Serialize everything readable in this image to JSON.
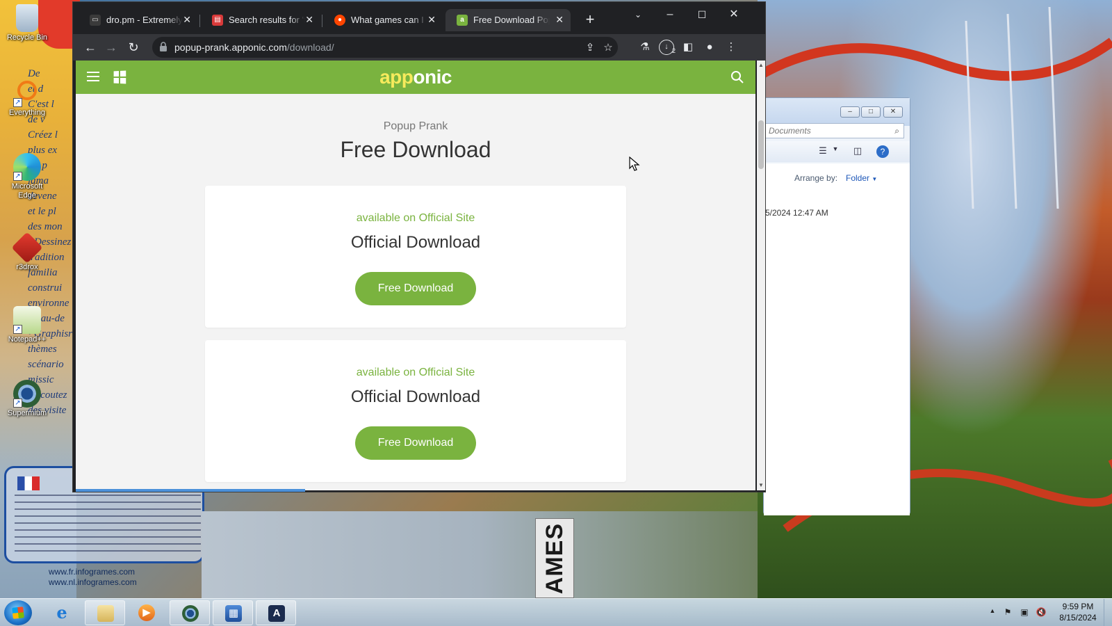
{
  "desktop": {
    "icons": [
      {
        "label": "Recycle Bin",
        "icon": "recycle-bin-icon"
      },
      {
        "label": "Everything",
        "icon": "everything-search-icon"
      },
      {
        "label": "Microsoft Edge",
        "icon": "edge-icon"
      },
      {
        "label": "r3drox",
        "icon": "r3drox-icon"
      },
      {
        "label": "Notepad++",
        "icon": "notepadpp-icon"
      },
      {
        "label": "Supermium",
        "icon": "supermium-icon"
      }
    ],
    "wallpaper_lines": [
      "De",
      "et d",
      "C'est l",
      "de v",
      "Créez l",
      "plus ex",
      "les p",
      "jama",
      "devene",
      "et le pl",
      "des mon",
      "• Dessinez",
      "tradition",
      "familia",
      "construi",
      "environne",
      "ou au-de",
      "• Graphisr",
      "thèmes",
      "scénario",
      "missic",
      "• Ecoutez",
      "des visite"
    ],
    "wallpaper_urls": [
      "www.fr.infogrames.com",
      "www.nl.infogrames.com"
    ],
    "games_label": "AMES"
  },
  "explorer": {
    "search_placeholder": "Documents",
    "arrange_label": "Arrange by:",
    "arrange_value": "Folder",
    "row_date": "5/2024 12:47 AM"
  },
  "browser": {
    "tabs": [
      {
        "title": "dro.pm - Extremely S",
        "favicon": "dro-pm-favicon",
        "active": false
      },
      {
        "title": "Search results for 'fr",
        "favicon": "search-favicon",
        "active": false
      },
      {
        "title": "What games can I do",
        "favicon": "reddit-favicon",
        "active": false
      },
      {
        "title": "Free Download Popup",
        "favicon": "apponic-favicon",
        "active": true
      }
    ],
    "url_host": "popup-prank.apponic.com",
    "url_path": "/download/",
    "download_badge": "2"
  },
  "page": {
    "logo_part1": "app",
    "logo_part2": "onic",
    "subtitle": "Popup Prank",
    "title": "Free Download",
    "cards": [
      {
        "availability": "available on Official Site",
        "title": "Official Download",
        "button": "Free Download"
      },
      {
        "availability": "available on Official Site",
        "title": "Official Download",
        "button": "Free Download"
      }
    ],
    "colors": {
      "brand_green": "#7ab33f",
      "logo_yellow": "#f6ea5c"
    }
  },
  "taskbar": {
    "apps": [
      "start-orb",
      "internet-explorer-icon",
      "file-explorer-icon",
      "media-player-icon",
      "supermium-icon",
      "app-blue-icon",
      "app-a-icon"
    ],
    "time": "9:59 PM",
    "date": "8/15/2024"
  }
}
